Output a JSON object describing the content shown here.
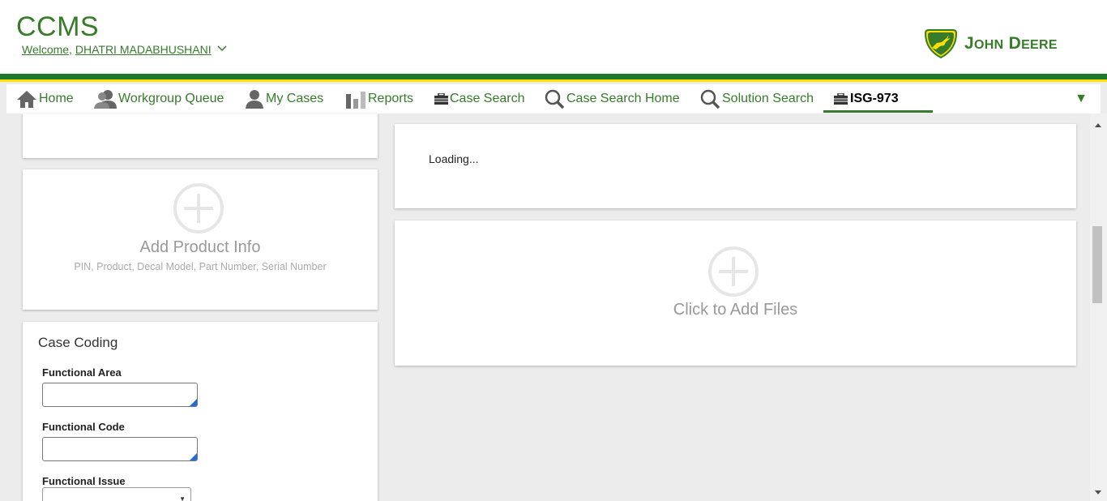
{
  "header": {
    "app_title": "CCMS",
    "welcome_prefix": "Welcome,",
    "user_name": "DHATRI MADABHUSHANI",
    "brand_first": "J",
    "brand_first_rest": "OHN",
    "brand_second": "D",
    "brand_second_rest": "EERE"
  },
  "nav": {
    "items": [
      {
        "label": "Home",
        "icon": "home-icon"
      },
      {
        "label": "Workgroup Queue",
        "icon": "workgroup-icon"
      },
      {
        "label": "My Cases",
        "icon": "user-icon"
      },
      {
        "label": "Reports",
        "icon": "bar-chart-icon"
      },
      {
        "label": "Case Search",
        "icon": "briefcase-icon"
      },
      {
        "label": "Case Search Home",
        "icon": "search-icon"
      },
      {
        "label": "Solution Search",
        "icon": "search-icon"
      },
      {
        "label": "ISG-973",
        "icon": "briefcase-icon",
        "active": true
      }
    ],
    "more_glyph": "▼"
  },
  "left_panel": {
    "product": {
      "title": "Add Product Info",
      "subtitle": "PIN, Product, Decal Model, Part Number, Serial Number"
    },
    "case_coding": {
      "title": "Case Coding",
      "functional_area_label": "Functional Area",
      "functional_area_value": "",
      "functional_code_label": "Functional Code",
      "functional_code_value": "",
      "functional_issue_label": "Functional Issue",
      "functional_issue_value": ""
    }
  },
  "right_panel": {
    "loading_text": "Loading...",
    "files_title": "Click to Add Files"
  },
  "colors": {
    "brand_green": "#367c2b",
    "stripe_green": "#1e7a2a",
    "stripe_yellow": "#ffde00"
  }
}
